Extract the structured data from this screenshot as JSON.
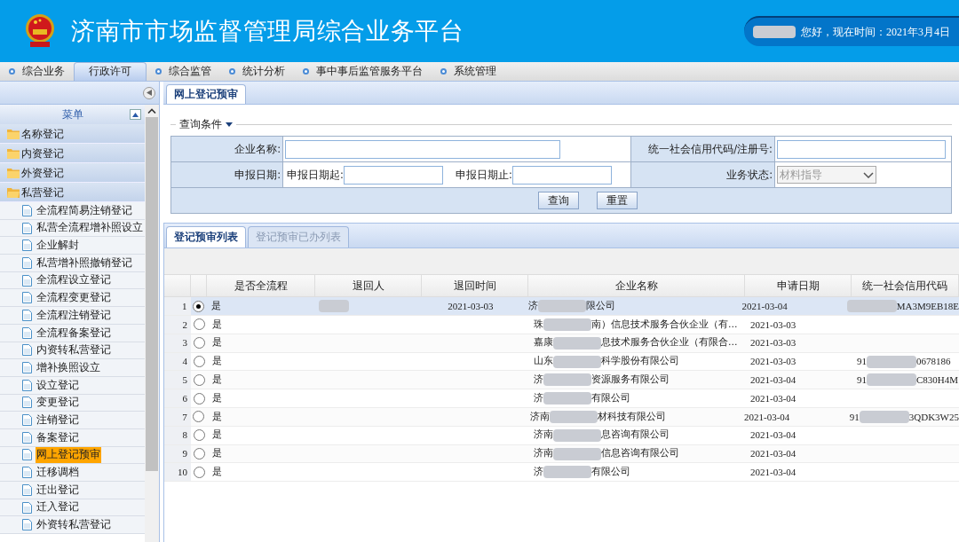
{
  "header": {
    "title": "济南市市场监督管理局综合业务平台",
    "greeting": "您好，现在时间：2021年3月4日"
  },
  "nav": [
    {
      "label": "综合业务",
      "selected": false
    },
    {
      "label": "行政许可",
      "selected": true
    },
    {
      "label": "综合监管",
      "selected": false
    },
    {
      "label": "统计分析",
      "selected": false
    },
    {
      "label": "事中事后监管服务平台",
      "selected": false
    },
    {
      "label": "系统管理",
      "selected": false
    }
  ],
  "sidebar": {
    "title": "菜单",
    "items": [
      {
        "label": "名称登记",
        "expanded": false
      },
      {
        "label": "内资登记",
        "expanded": false
      },
      {
        "label": "外资登记",
        "expanded": false
      },
      {
        "label": "私营登记",
        "expanded": true,
        "children": [
          {
            "label": "全流程简易注销登记",
            "selected": false
          },
          {
            "label": "私营全流程增补照设立",
            "selected": false
          },
          {
            "label": "企业解封",
            "selected": false
          },
          {
            "label": "私营增补照撤销登记",
            "selected": false
          },
          {
            "label": "全流程设立登记",
            "selected": false
          },
          {
            "label": "全流程变更登记",
            "selected": false
          },
          {
            "label": "全流程注销登记",
            "selected": false
          },
          {
            "label": "全流程备案登记",
            "selected": false
          },
          {
            "label": "内资转私营登记",
            "selected": false
          },
          {
            "label": "增补换照设立",
            "selected": false
          },
          {
            "label": "设立登记",
            "selected": false
          },
          {
            "label": "变更登记",
            "selected": false
          },
          {
            "label": "注销登记",
            "selected": false
          },
          {
            "label": "备案登记",
            "selected": false
          },
          {
            "label": "网上登记预审",
            "selected": true
          },
          {
            "label": "迁移调档",
            "selected": false
          },
          {
            "label": "迁出登记",
            "selected": false
          },
          {
            "label": "迁入登记",
            "selected": false
          },
          {
            "label": "外资转私营登记",
            "selected": false
          }
        ]
      }
    ]
  },
  "page_tab": "网上登记预审",
  "query": {
    "title": "查询条件",
    "company_label": "企业名称:",
    "credit_label": "统一社会信用代码/注册号:",
    "date_label": "申报日期:",
    "date_from_label": "申报日期起:",
    "date_to_label": "申报日期止:",
    "status_label": "业务状态:",
    "status_value": "材料指导",
    "search_button": "查询",
    "reset_button": "重置"
  },
  "list_tabs": [
    {
      "label": "登记预审列表",
      "selected": true
    },
    {
      "label": "登记预审已办列表",
      "selected": false
    }
  ],
  "table": {
    "columns": [
      "是否全流程",
      "退回人",
      "退回时间",
      "企业名称",
      "申请日期",
      "统一社会信用代码"
    ],
    "rows": [
      {
        "index": "1",
        "selected": true,
        "full_process": "是",
        "returner_redacted": true,
        "return_time": "2021-03-03",
        "name_start": "济",
        "name_end": "限公司",
        "date": "2021-03-04",
        "code_start": "",
        "code_end": "MA3M9EB18E",
        "code_redacted": true
      },
      {
        "index": "2",
        "selected": false,
        "full_process": "是",
        "returner_redacted": false,
        "return_time": "",
        "name_start": "珠",
        "name_end": "南）信息技术服务合伙企业（有...",
        "date": "2021-03-03",
        "code_start": "",
        "code_end": "",
        "code_redacted": false
      },
      {
        "index": "3",
        "selected": false,
        "full_process": "是",
        "returner_redacted": false,
        "return_time": "",
        "name_start": "嘉康",
        "name_end": "息技术服务合伙企业（有限合...",
        "date": "2021-03-03",
        "code_start": "",
        "code_end": "",
        "code_redacted": false
      },
      {
        "index": "4",
        "selected": false,
        "full_process": "是",
        "returner_redacted": false,
        "return_time": "",
        "name_start": "山东",
        "name_end": "科学股份有限公司",
        "date": "2021-03-03",
        "code_start": "91",
        "code_end": "0678186",
        "code_redacted": true
      },
      {
        "index": "5",
        "selected": false,
        "full_process": "是",
        "returner_redacted": false,
        "return_time": "",
        "name_start": "济",
        "name_end": "资源服务有限公司",
        "date": "2021-03-04",
        "code_start": "91",
        "code_end": "C830H4M",
        "code_redacted": true
      },
      {
        "index": "6",
        "selected": false,
        "full_process": "是",
        "returner_redacted": false,
        "return_time": "",
        "name_start": "济",
        "name_end": "有限公司",
        "date": "2021-03-04",
        "code_start": "",
        "code_end": "",
        "code_redacted": false
      },
      {
        "index": "7",
        "selected": false,
        "full_process": "是",
        "returner_redacted": false,
        "return_time": "",
        "name_start": "济南",
        "name_end": "材科技有限公司",
        "date": "2021-03-04",
        "code_start": "91",
        "code_end": "3QDK3W25",
        "code_redacted": true
      },
      {
        "index": "8",
        "selected": false,
        "full_process": "是",
        "returner_redacted": false,
        "return_time": "",
        "name_start": "济南",
        "name_end": "息咨询有限公司",
        "date": "2021-03-04",
        "code_start": "",
        "code_end": "",
        "code_redacted": false
      },
      {
        "index": "9",
        "selected": false,
        "full_process": "是",
        "returner_redacted": false,
        "return_time": "",
        "name_start": "济南",
        "name_end": "信息咨询有限公司",
        "date": "2021-03-04",
        "code_start": "",
        "code_end": "",
        "code_redacted": false
      },
      {
        "index": "10",
        "selected": false,
        "full_process": "是",
        "returner_redacted": false,
        "return_time": "",
        "name_start": "济",
        "name_end": "有限公司",
        "date": "2021-03-04",
        "code_start": "",
        "code_end": "",
        "code_redacted": false
      }
    ]
  }
}
